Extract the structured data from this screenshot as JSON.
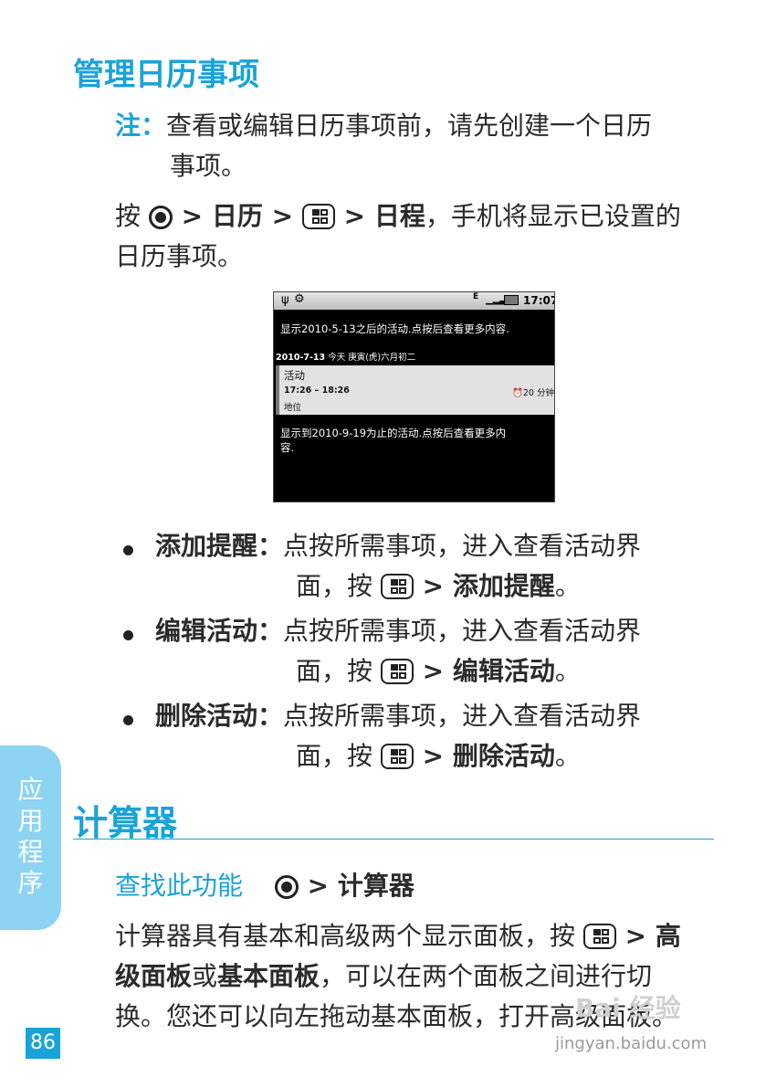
{
  "section1": {
    "title": "管理日历事项",
    "note_label": "注：",
    "note_line1": "查看或编辑日历事项前，请先创建一个日历",
    "note_line2": "事项。",
    "instr": {
      "press": "按",
      "sep1": " > ",
      "calendar": "日历",
      "sep2": " > ",
      "sep3": " > ",
      "schedule": "日程",
      "rest": "，手机将显示已设置的",
      "line2": "日历事项。"
    }
  },
  "phone": {
    "status_time": "17:07",
    "status_network": "E",
    "header_text": "显示2010-5-13之后的活动.点按后查看更多内容.",
    "date_bold": "2010-7-13",
    "date_rest": " 今天  庚寅(虎)六月初二",
    "event_title": "活动",
    "event_time": "17:26 – 18:26",
    "event_reminder": "20 分钟",
    "event_location": "地位",
    "footer_line1": "显示到2010-9-19为止的活动.点按后查看更多内",
    "footer_line2": "容."
  },
  "bullets": [
    {
      "label": "添加提醒",
      "colon": "：",
      "line1": "点按所需事项，进入查看活动界",
      "line2_pre": "面，按",
      "sep": " > ",
      "action": "添加提醒",
      "end": "。"
    },
    {
      "label": "编辑活动",
      "colon": "：",
      "line1": "点按所需事项，进入查看活动界",
      "line2_pre": "面，按",
      "sep": " > ",
      "action": "编辑活动",
      "end": "。"
    },
    {
      "label": "删除活动",
      "colon": "：",
      "line1": "点按所需事项，进入查看活动界",
      "line2_pre": "面，按",
      "sep": " > ",
      "action": "删除活动",
      "end": "。"
    }
  ],
  "section2": {
    "title": "计算器",
    "find_label": "查找此功能",
    "find_sep": " > ",
    "find_target": "计算器",
    "para_line1_pre": "计算器具有基本和高级两个显示面板，按",
    "para_line1_sep": " > ",
    "para_line1_bold": "高",
    "para_line2_bold1": "级面板",
    "para_line2_or": "或",
    "para_line2_bold2": "基本面板",
    "para_line2_rest": "，可以在两个面板之间进行切",
    "para_line3": "换。您还可以向左拖动基本面板，打开高级面板。"
  },
  "side_tab": [
    "应",
    "用",
    "程",
    "序"
  ],
  "page_number": "86",
  "watermark": {
    "text": "Bai 经验",
    "url": "jingyan.baidu.com"
  },
  "colors": {
    "accent": "#1aa3d6",
    "side_tab": "#8dd3f2"
  }
}
